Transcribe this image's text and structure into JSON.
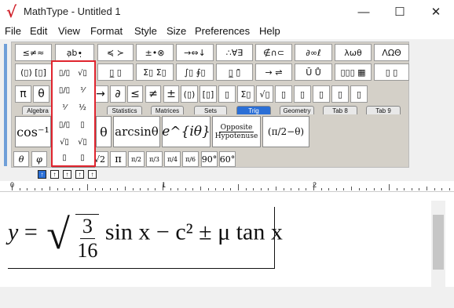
{
  "window": {
    "title": "MathType - Untitled 1",
    "minimize": "—",
    "maximize": "☐",
    "close": "✕",
    "icon": "√"
  },
  "menu": [
    "File",
    "Edit",
    "View",
    "Format",
    "Style",
    "Size",
    "Preferences",
    "Help"
  ],
  "palette_row1": [
    "≤≠≈",
    "ạb∙̣",
    "≼ ≻",
    "±•⊗",
    "→⇔↓",
    "∴∀∃",
    "∉∩⊂",
    "∂∞ℓ",
    "λωθ",
    "ΛΩΘ"
  ],
  "palette_row2": [
    "(▯) [▯]",
    "√▯",
    "▯̲ ▯",
    "Σ▯ Σ▯",
    "∫▯ ∮▯",
    "▯̲ ▯̄",
    "→ ⇌",
    "Ū Ů",
    "▯▯▯ ▦",
    "▯ ▯"
  ],
  "symbols_row3": [
    "π",
    "θ",
    "∞",
    "→",
    "∂",
    "≤",
    "≠",
    "±",
    "(▯)",
    "[▯]",
    "▯",
    "Σ▯",
    "√▯",
    "▯",
    "▯",
    "▯",
    "▯",
    "▯"
  ],
  "tabs": [
    "Algebra",
    "Statistics",
    "Matrices",
    "Sets",
    "Trig",
    "Geometry",
    "Tab 8",
    "Tab 9"
  ],
  "active_tab": "Trig",
  "trig_items": [
    "cos⁻¹",
    "θ",
    "arcsinθ",
    "e^{iθ}",
    "Opposite",
    "Hypotenuse",
    "(π/2−θ)"
  ],
  "bottom_symbols": [
    "θ",
    "φ",
    "√2",
    "π",
    "π/2",
    "π/3",
    "π/4",
    "π/6",
    "90°",
    "60°"
  ],
  "dropdown": [
    "▯/▯",
    "√▯",
    "▯/▯",
    "⅟",
    "⅟",
    "½",
    "▯/▯",
    "▯",
    "√▯",
    "√▯",
    "▯",
    "▯"
  ],
  "ruler": [
    "0",
    "1",
    "2"
  ],
  "equation": {
    "lhs": "y",
    "eq": "=",
    "num": "3",
    "den": "16",
    "tail": "sin x − c² ± μ tan x"
  }
}
